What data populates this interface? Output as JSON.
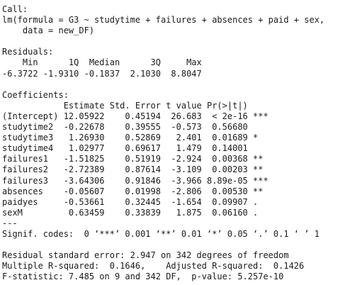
{
  "console": {
    "lines": [
      "Call:",
      "lm(formula = G3 ~ studytime + failures + absences + paid + sex,",
      "    data = new_DF)",
      "",
      "Residuals:",
      "    Min      1Q  Median      3Q     Max ",
      "-6.3722 -1.9310 -0.1837  2.1030  8.8047 ",
      "",
      "Coefficients:",
      "            Estimate Std. Error t value Pr(>|t|)    ",
      "(Intercept) 12.05922    0.45194  26.683  < 2e-16 ***",
      "studytime2  -0.22678    0.39555  -0.573  0.56680    ",
      "studytime3   1.26930    0.52869   2.401  0.01689 *  ",
      "studytime4   1.02977    0.69617   1.479  0.14001    ",
      "failures1   -1.51825    0.51919  -2.924  0.00368 ** ",
      "failures2   -2.72389    0.87614  -3.109  0.00203 ** ",
      "failures3   -3.64306    0.91846  -3.966 8.89e-05 ***",
      "absences    -0.05607    0.01998  -2.806  0.00530 ** ",
      "paidyes     -0.53661    0.32445  -1.654  0.09907 .  ",
      "sexM         0.63459    0.33839   1.875  0.06160 .  ",
      "---",
      "Signif. codes:  0 ‘***’ 0.001 ‘**’ 0.01 ‘*’ 0.05 ‘.’ 0.1 ‘ ’ 1",
      "",
      "Residual standard error: 2.947 on 342 degrees of freedom",
      "Multiple R-squared:  0.1646,\tAdjusted R-squared:  0.1426 ",
      "F-statistic: 7.485 on 9 and 342 DF,  p-value: 5.257e-10"
    ]
  }
}
